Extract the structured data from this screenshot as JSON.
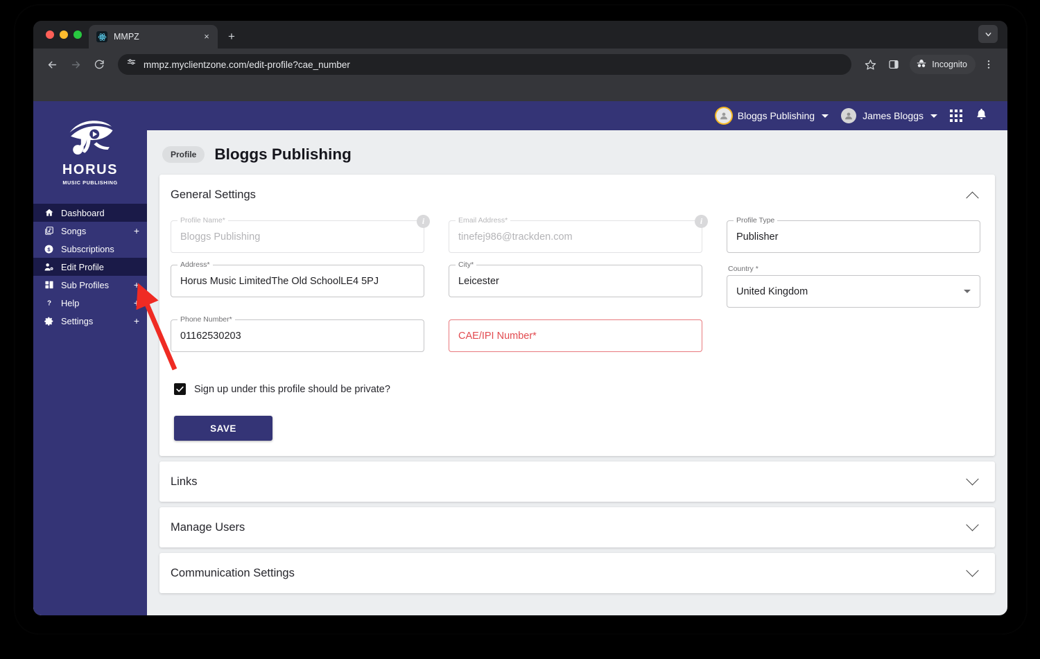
{
  "browser": {
    "tab": {
      "title": "MMPZ",
      "favicon": "react-atom-icon",
      "close": "×"
    },
    "new_tab_label": "+",
    "url": "mmpz.myclientzone.com/edit-profile?cae_number",
    "incognito_label": "Incognito"
  },
  "sidebar": {
    "logo": {
      "word": "HORUS",
      "sub": "MUSIC PUBLISHING"
    },
    "items": [
      {
        "label": "Dashboard",
        "icon": "home-icon",
        "plus": "",
        "active": true
      },
      {
        "label": "Songs",
        "icon": "songs-icon",
        "plus": "+",
        "active": false
      },
      {
        "label": "Subscriptions",
        "icon": "dollar-circle-icon",
        "plus": "",
        "active": false
      },
      {
        "label": "Edit Profile",
        "icon": "user-edit-icon",
        "plus": "",
        "active": true
      },
      {
        "label": "Sub Profiles",
        "icon": "sub-profiles-icon",
        "plus": "+",
        "active": false
      },
      {
        "label": "Help",
        "icon": "question-icon",
        "plus": "+",
        "active": false
      },
      {
        "label": "Settings",
        "icon": "gear-icon",
        "plus": "+",
        "active": false
      }
    ]
  },
  "topbar": {
    "org_name": "Bloggs Publishing",
    "user_name": "James Bloggs"
  },
  "page": {
    "badge": "Profile",
    "title": "Bloggs Publishing"
  },
  "general_settings": {
    "heading": "General Settings",
    "fields": {
      "profile_name": {
        "label": "Profile Name",
        "required": "*",
        "value": "Bloggs Publishing"
      },
      "email_address": {
        "label": "Email Address",
        "required": "*",
        "value": "tinefej986@trackden.com"
      },
      "profile_type": {
        "label": "Profile Type",
        "required": "",
        "value": "Publisher"
      },
      "address": {
        "label": "Address",
        "required": "*",
        "value": "Horus Music LimitedThe Old SchoolLE4 5PJ"
      },
      "city": {
        "label": "City",
        "required": "*",
        "value": "Leicester"
      },
      "country": {
        "label": "Country ",
        "required": "*",
        "value": "United Kingdom"
      },
      "phone_number": {
        "label": "Phone Number",
        "required": "*",
        "value": "01162530203"
      },
      "cae_ipi": {
        "label": "CAE/IPI Number",
        "required": "*",
        "value": ""
      }
    },
    "private_checkbox_label": "Sign up under this profile should be private?",
    "save_label": "SAVE"
  },
  "collapsed_sections": [
    {
      "label": "Links"
    },
    {
      "label": "Manage Users"
    },
    {
      "label": "Communication Settings"
    }
  ],
  "colors": {
    "brand_navy": "#343476",
    "active_navy": "#1a1a48",
    "error_red": "#e24a4f",
    "annotation_red": "#ef2b23",
    "org_ring_yellow": "#f5b722"
  }
}
